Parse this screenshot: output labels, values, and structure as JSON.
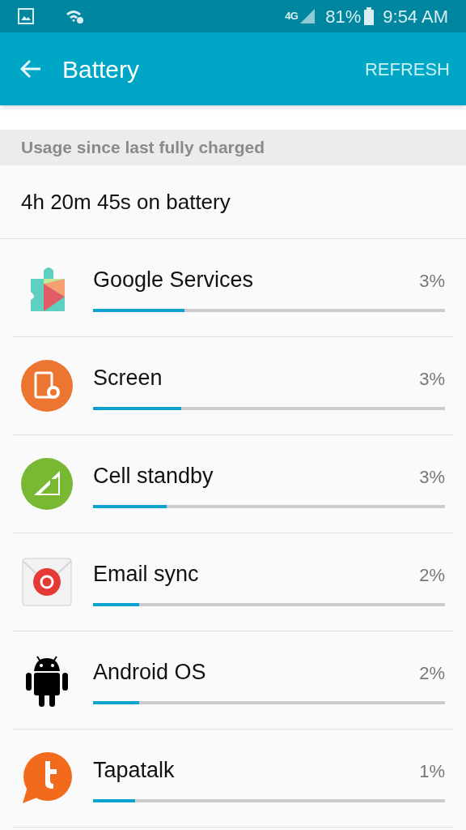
{
  "status_bar": {
    "battery": "81%",
    "time": "9:54 AM",
    "network": "4G"
  },
  "app_bar": {
    "title": "Battery",
    "action": "REFRESH"
  },
  "section_header": "Usage since last fully charged",
  "summary": "4h 20m 45s on battery",
  "apps": [
    {
      "kind": "puzzle",
      "name": "Google Services",
      "percent": "3%",
      "level": 0.26
    },
    {
      "kind": "screen",
      "name": "Screen",
      "percent": "3%",
      "level": 0.25
    },
    {
      "kind": "cell",
      "name": "Cell standby",
      "percent": "3%",
      "level": 0.21
    },
    {
      "kind": "email",
      "name": "Email sync",
      "percent": "2%",
      "level": 0.13
    },
    {
      "kind": "android",
      "name": "Android OS",
      "percent": "2%",
      "level": 0.13
    },
    {
      "kind": "tapatalk",
      "name": "Tapatalk",
      "percent": "1%",
      "level": 0.12
    }
  ]
}
